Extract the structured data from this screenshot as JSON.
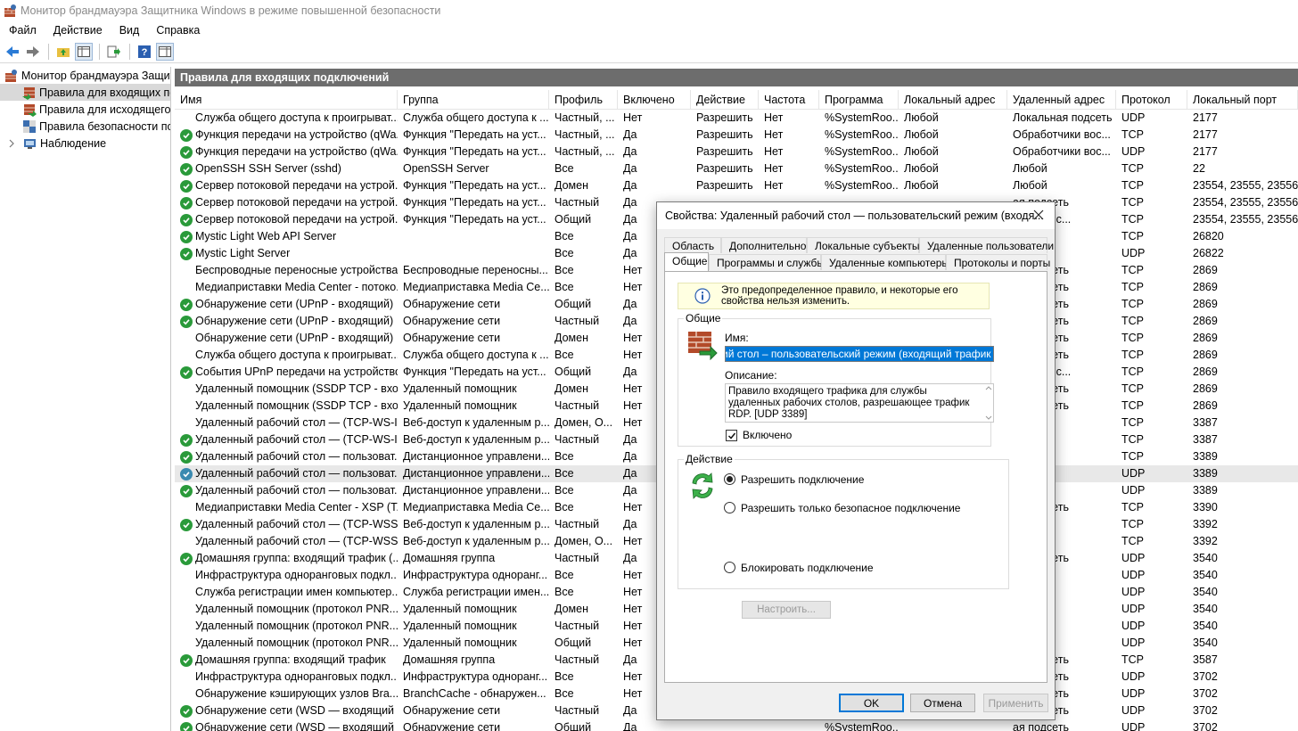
{
  "window": {
    "title": "Монитор брандмауэра Защитника Windows в режиме повышенной безопасности"
  },
  "menu": [
    "Файл",
    "Действие",
    "Вид",
    "Справка"
  ],
  "tree": {
    "root": "Монитор брандмауэра Защит",
    "items": [
      "Правила для входящих по",
      "Правила для исходящего п",
      "Правила безопасности по,",
      "Наблюдение"
    ]
  },
  "main": {
    "header": "Правила для входящих подключений",
    "columns": [
      "Имя",
      "Группа",
      "Профиль",
      "Включено",
      "Действие",
      "Частота",
      "Программа",
      "Локальный адрес",
      "Удаленный адрес",
      "Протокол",
      "Локальный порт"
    ],
    "rows": [
      {
        "e": false,
        "c": [
          "Служба общего доступа к проигрыват...",
          "Служба общего доступа к ...",
          "Частный, ...",
          "Нет",
          "Разрешить",
          "Нет",
          "%SystemRoo...",
          "Любой",
          "Локальная подсеть",
          "UDP",
          "2177"
        ]
      },
      {
        "e": true,
        "c": [
          "Функция передачи на устройство (qWa...",
          "Функция \"Передать на уст...",
          "Частный, ...",
          "Да",
          "Разрешить",
          "Нет",
          "%SystemRoo...",
          "Любой",
          "Обработчики вос...",
          "TCP",
          "2177"
        ]
      },
      {
        "e": true,
        "c": [
          "Функция передачи на устройство (qWa...",
          "Функция \"Передать на уст...",
          "Частный, ...",
          "Да",
          "Разрешить",
          "Нет",
          "%SystemRoo...",
          "Любой",
          "Обработчики вос...",
          "UDP",
          "2177"
        ]
      },
      {
        "e": true,
        "c": [
          "OpenSSH SSH Server (sshd)",
          "OpenSSH Server",
          "Все",
          "Да",
          "Разрешить",
          "Нет",
          "%SystemRoo...",
          "Любой",
          "Любой",
          "TCP",
          "22"
        ]
      },
      {
        "e": true,
        "c": [
          "Сервер потоковой передачи на устрой...",
          "Функция \"Передать на уст...",
          "Домен",
          "Да",
          "Разрешить",
          "Нет",
          "%SystemRoo...",
          "Любой",
          "Любой",
          "TCP",
          "23554, 23555, 23556"
        ]
      },
      {
        "e": true,
        "c": [
          "Сервер потоковой передачи на устрой...",
          "Функция \"Передать на уст...",
          "Частный",
          "Да",
          "",
          "",
          "",
          "",
          "ая подсеть",
          "TCP",
          "23554, 23555, 23556"
        ]
      },
      {
        "e": true,
        "c": [
          "Сервер потоковой передачи на устрой...",
          "Функция \"Передать на уст...",
          "Общий",
          "Да",
          "",
          "",
          "",
          "",
          "тчики вос...",
          "TCP",
          "23554, 23555, 23556"
        ]
      },
      {
        "e": true,
        "c": [
          "Mystic Light Web API Server",
          "",
          "Все",
          "Да",
          "",
          "",
          "",
          "",
          "",
          "TCP",
          "26820"
        ]
      },
      {
        "e": true,
        "c": [
          "Mystic Light Server",
          "",
          "Все",
          "Да",
          "",
          "",
          "",
          "",
          "",
          "UDP",
          "26822"
        ]
      },
      {
        "e": false,
        "c": [
          "Беспроводные переносные устройства...",
          "Беспроводные переносны...",
          "Все",
          "Нет",
          "",
          "",
          "",
          "",
          "ая подсеть",
          "TCP",
          "2869"
        ]
      },
      {
        "e": false,
        "c": [
          "Медиаприставки Media Center - потоко...",
          "Медиаприставка Media Ce...",
          "Все",
          "Нет",
          "",
          "",
          "",
          "",
          "ая подсеть",
          "TCP",
          "2869"
        ]
      },
      {
        "e": true,
        "c": [
          "Обнаружение сети (UPnP - входящий)",
          "Обнаружение сети",
          "Общий",
          "Да",
          "",
          "",
          "",
          "",
          "ая подсеть",
          "TCP",
          "2869"
        ]
      },
      {
        "e": true,
        "c": [
          "Обнаружение сети (UPnP - входящий)",
          "Обнаружение сети",
          "Частный",
          "Да",
          "",
          "",
          "",
          "",
          "ая подсеть",
          "TCP",
          "2869"
        ]
      },
      {
        "e": false,
        "c": [
          "Обнаружение сети (UPnP - входящий)",
          "Обнаружение сети",
          "Домен",
          "Нет",
          "",
          "",
          "",
          "",
          "ая подсеть",
          "TCP",
          "2869"
        ]
      },
      {
        "e": false,
        "c": [
          "Служба общего доступа к проигрыват...",
          "Служба общего доступа к ...",
          "Все",
          "Нет",
          "",
          "",
          "",
          "",
          "ая подсеть",
          "TCP",
          "2869"
        ]
      },
      {
        "e": true,
        "c": [
          "События UPnP передачи на устройство...",
          "Функция \"Передать на уст...",
          "Общий",
          "Да",
          "",
          "",
          "",
          "",
          "тчики вос...",
          "TCP",
          "2869"
        ]
      },
      {
        "e": false,
        "c": [
          "Удаленный помощник (SSDP TCP - вхо...",
          "Удаленный помощник",
          "Домен",
          "Нет",
          "",
          "",
          "",
          "",
          "ая подсеть",
          "TCP",
          "2869"
        ]
      },
      {
        "e": false,
        "c": [
          "Удаленный помощник (SSDP TCP - вхо...",
          "Удаленный помощник",
          "Частный",
          "Нет",
          "",
          "",
          "",
          "",
          "ая подсеть",
          "TCP",
          "2869"
        ]
      },
      {
        "e": false,
        "c": [
          "Удаленный рабочий стол — (TCP-WS-In)",
          "Веб-доступ к удаленным р...",
          "Домен, О...",
          "Нет",
          "",
          "",
          "",
          "",
          "",
          "TCP",
          "3387"
        ]
      },
      {
        "e": true,
        "c": [
          "Удаленный рабочий стол — (TCP-WS-In)",
          "Веб-доступ к удаленным р...",
          "Частный",
          "Да",
          "",
          "",
          "",
          "",
          "",
          "TCP",
          "3387"
        ]
      },
      {
        "e": true,
        "c": [
          "Удаленный рабочий стол — пользоват...",
          "Дистанционное управлени...",
          "Все",
          "Да",
          "",
          "",
          "",
          "",
          "",
          "TCP",
          "3389"
        ]
      },
      {
        "e": true,
        "blue": true,
        "hl": true,
        "c": [
          "Удаленный рабочий стол — пользоват...",
          "Дистанционное управлени...",
          "Все",
          "Да",
          "",
          "",
          "",
          "",
          "",
          "UDP",
          "3389"
        ]
      },
      {
        "e": true,
        "c": [
          "Удаленный рабочий стол — пользоват...",
          "Дистанционное управлени...",
          "Все",
          "Да",
          "",
          "",
          "",
          "",
          "",
          "UDP",
          "3389"
        ]
      },
      {
        "e": false,
        "c": [
          "Медиаприставки Media Center - XSP (T...",
          "Медиаприставка Media Ce...",
          "Все",
          "Нет",
          "",
          "",
          "",
          "",
          "ая подсеть",
          "TCP",
          "3390"
        ]
      },
      {
        "e": true,
        "c": [
          "Удаленный рабочий стол — (TCP-WSS ...",
          "Веб-доступ к удаленным р...",
          "Частный",
          "Да",
          "",
          "",
          "",
          "",
          "",
          "TCP",
          "3392"
        ]
      },
      {
        "e": false,
        "c": [
          "Удаленный рабочий стол — (TCP-WSS ...",
          "Веб-доступ к удаленным р...",
          "Домен, О...",
          "Нет",
          "",
          "",
          "",
          "",
          "",
          "TCP",
          "3392"
        ]
      },
      {
        "e": true,
        "c": [
          "Домашняя группа: входящий трафик (...",
          "Домашняя группа",
          "Частный",
          "Да",
          "",
          "",
          "",
          "",
          "ая подсеть",
          "UDP",
          "3540"
        ]
      },
      {
        "e": false,
        "c": [
          "Инфраструктура одноранговых подкл...",
          "Инфраструктура одноранг...",
          "Все",
          "Нет",
          "",
          "",
          "",
          "",
          "",
          "UDP",
          "3540"
        ]
      },
      {
        "e": false,
        "c": [
          "Служба регистрации имен компьютер...",
          "Служба регистрации имен...",
          "Все",
          "Нет",
          "",
          "",
          "",
          "",
          "",
          "UDP",
          "3540"
        ]
      },
      {
        "e": false,
        "c": [
          "Удаленный помощник (протокол PNR...",
          "Удаленный помощник",
          "Домен",
          "Нет",
          "",
          "",
          "",
          "",
          "",
          "UDP",
          "3540"
        ]
      },
      {
        "e": false,
        "c": [
          "Удаленный помощник (протокол PNR...",
          "Удаленный помощник",
          "Частный",
          "Нет",
          "",
          "",
          "",
          "",
          "",
          "UDP",
          "3540"
        ]
      },
      {
        "e": false,
        "c": [
          "Удаленный помощник (протокол PNR...",
          "Удаленный помощник",
          "Общий",
          "Нет",
          "",
          "",
          "",
          "",
          "",
          "UDP",
          "3540"
        ]
      },
      {
        "e": true,
        "c": [
          "Домашняя группа: входящий трафик",
          "Домашняя группа",
          "Частный",
          "Да",
          "",
          "",
          "",
          "",
          "ая подсеть",
          "TCP",
          "3587"
        ]
      },
      {
        "e": false,
        "c": [
          "Инфраструктура одноранговых подкл...",
          "Инфраструктура одноранг...",
          "Все",
          "Нет",
          "",
          "",
          "",
          "",
          "ая подсеть",
          "UDP",
          "3702"
        ]
      },
      {
        "e": false,
        "c": [
          "Обнаружение кэширующих узлов Bra...",
          "BranchCache - обнаружен...",
          "Все",
          "Нет",
          "",
          "",
          "",
          "",
          "ая подсеть",
          "UDP",
          "3702"
        ]
      },
      {
        "e": true,
        "c": [
          "Обнаружение сети (WSD — входящий ...",
          "Обнаружение сети",
          "Частный",
          "Да",
          "",
          "",
          "",
          "",
          "ая подсеть",
          "UDP",
          "3702"
        ]
      },
      {
        "e": true,
        "c": [
          "Обнаружение сети (WSD — входящий ...",
          "Обнаружение сети",
          "Общий",
          "Да",
          "",
          "",
          "%SystemRoo...",
          "",
          "ая подсеть",
          "UDP",
          "3702"
        ]
      }
    ]
  },
  "dialog": {
    "title": "Свойства: Удаленный рабочий стол — пользовательский режим (входя...",
    "tabs_row1": [
      "Область",
      "Дополнительно",
      "Локальные субъекты",
      "Удаленные пользователи"
    ],
    "tabs_row2": [
      "Общие",
      "Программы и службы",
      "Удаленные компьютеры",
      "Протоколы и порты"
    ],
    "info": "Это предопределенное правило, и некоторые его свойства нельзя изменить.",
    "general_group": "Общие",
    "name_label": "Имя:",
    "name_value": "ий стол – пользовательский режим (входящий трафик UDP",
    "desc_label": "Описание:",
    "desc_value": "Правило входящего трафика для службы удаленных рабочих столов, разрешающее трафик RDP. [UDP 3389]",
    "enabled_label": "Включено",
    "action_group": "Действие",
    "allow": "Разрешить подключение",
    "allow_secure": "Разрешить только безопасное подключение",
    "customize": "Настроить...",
    "block": "Блокировать подключение",
    "ok": "OK",
    "cancel": "Отмена",
    "apply": "Применить"
  },
  "colors": {
    "accent": "#0078d7",
    "header_bg": "#6d6d6d",
    "enabled_icon": "#2a9a3a"
  }
}
